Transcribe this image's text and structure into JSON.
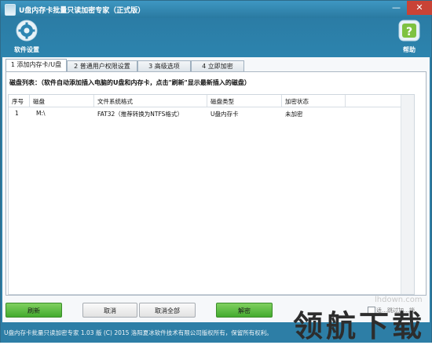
{
  "window": {
    "title": "U盘内存卡批量只读加密专家（正式版）",
    "minimize_glyph": "—",
    "close_glyph": "✕"
  },
  "toolbar": {
    "settings_label": "软件设置",
    "help_label": "帮助"
  },
  "tabs": [
    {
      "label": "1 添加内存卡/U盘",
      "active": true
    },
    {
      "label": "2 普通用户权限设置",
      "active": false
    },
    {
      "label": "3 高级选项",
      "active": false
    },
    {
      "label": "4 立即加密",
      "active": false
    }
  ],
  "panel": {
    "hint": "磁盘列表：（软件自动添加插入电脑的U盘和内存卡，点击\"刷新\"显示最新插入的磁盘）"
  },
  "table": {
    "columns": [
      "序号",
      "磁盘",
      "文件系统格式",
      "磁盘类型",
      "加密状态"
    ],
    "rows": [
      [
        "1",
        "M:\\",
        "FAT32（推荐转换为NTFS格式）",
        "U盘内存卡",
        "未加密"
      ]
    ]
  },
  "buttons": {
    "refresh": "刷新",
    "cancel": "取消",
    "cancel_all": "取消全部",
    "decrypt": "解密"
  },
  "option_checkbox": {
    "label": "适…跳过加…锁"
  },
  "status": {
    "text": "U盘内存卡批量只读加密专家 1.03 版  (C)  2015 洛阳夏冰软件技术有限公司版权所有，保留所有权利。"
  },
  "watermark": {
    "site": "lhdown.com",
    "logo": "领航下载"
  },
  "colors": {
    "title_bar": "#2e7fa6",
    "status_bar": "#2d7ea6",
    "green_button": "#4fb438",
    "close_button": "#c94336"
  }
}
